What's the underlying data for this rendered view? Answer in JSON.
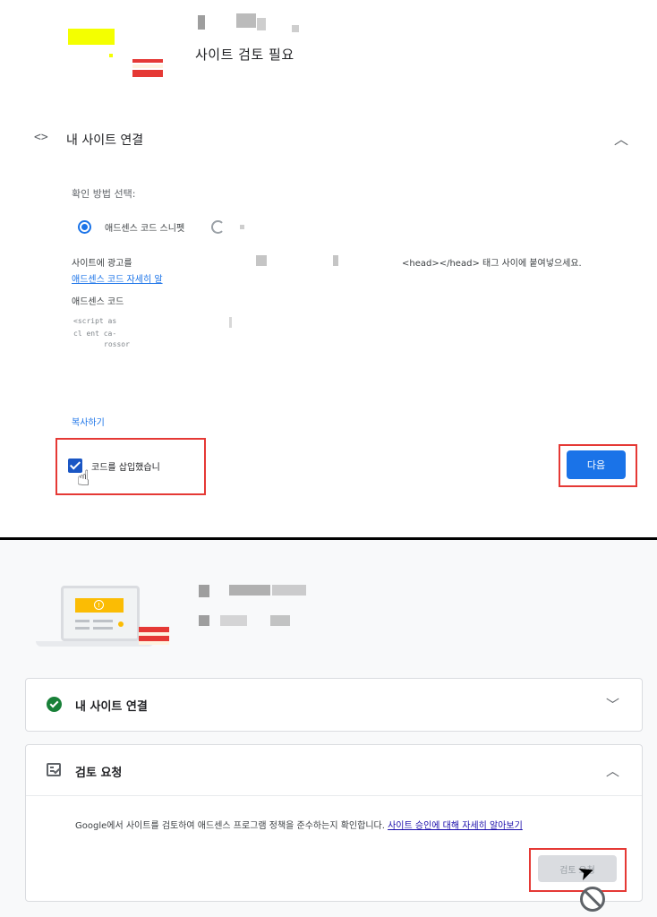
{
  "colors": {
    "accent": "#1a73e8",
    "highlight_border": "#e53935",
    "success": "#188038",
    "disabled_button": "#dadce0"
  },
  "top": {
    "title": "사이트 검토 필요",
    "connect_section": {
      "icon": "code-icon",
      "icon_glyph": "<>",
      "title": "내 사이트 연결",
      "chevron": "chevron-up-icon"
    },
    "method_label": "확인 방법 선택:",
    "radio_option_selected": "애드센스 코드 스니펫",
    "description_left": "사이트에 광고를",
    "description_right": "<head></head> 태그 사이에 붙여넣으세요.",
    "learn_more_link": "애드센스 코드 자세히 알",
    "code_label": "애드센스 코드",
    "code_lines": [
      "<script as",
      "cl ent ca-",
      "rossor"
    ],
    "copy_link": "복사하기",
    "checkbox": {
      "label": "코드를 삽입했습니",
      "checked": true
    },
    "next_button": "다음"
  },
  "bottom": {
    "card1": {
      "status_icon": "check-circle-icon",
      "title": "내 사이트 연결",
      "chevron": "chevron-down-icon"
    },
    "card2": {
      "icon": "review-checklist-icon",
      "title": "검토 요청",
      "chevron": "chevron-up-icon",
      "description": "Google에서 사이트를 검토하여 애드센스 프로그램 정책을 준수하는지 확인합니다.",
      "link": "사이트 승인에 대해 자세히 알아보기",
      "button": "검토 요청",
      "button_disabled": true
    }
  }
}
